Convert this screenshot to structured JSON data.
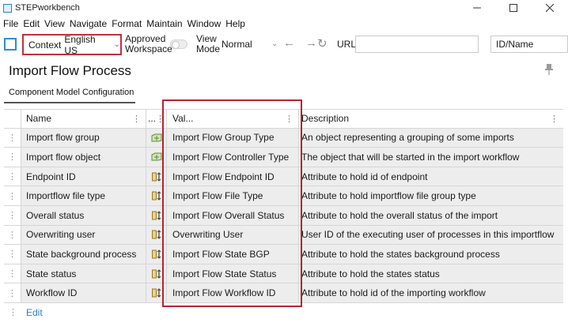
{
  "window": {
    "title": "STEPworkbench"
  },
  "menu": [
    "File",
    "Edit",
    "View",
    "Navigate",
    "Format",
    "Maintain",
    "Window",
    "Help"
  ],
  "toolbar": {
    "context_label": "Context",
    "context_value": "English US",
    "approved_line1": "Approved",
    "approved_line2": "Workspace",
    "view_line1": "View",
    "view_line2": "Mode",
    "view_mode_value": "Normal",
    "url_label": "URL",
    "id_name_value": "ID/Name"
  },
  "page": {
    "title": "Import Flow Process",
    "tab": "Component Model Configuration"
  },
  "table": {
    "columns": {
      "name": "Name",
      "icon": "...",
      "val": "Val...",
      "description": "Description"
    },
    "rows": [
      {
        "name": "Import flow group",
        "icon": "object-type-icon",
        "val": "Import Flow Group Type",
        "description": "An object representing a grouping of some imports"
      },
      {
        "name": "Import flow object",
        "icon": "object-type-icon",
        "val": "Import Flow Controller Type",
        "description": "The object that will be started in the import workflow"
      },
      {
        "name": "Endpoint ID",
        "icon": "attribute-icon",
        "val": "Import Flow Endpoint ID",
        "description": "Attribute to hold id of endpoint"
      },
      {
        "name": "Importflow file type",
        "icon": "attribute-icon",
        "val": "Import Flow File Type",
        "description": "Attribute to hold importflow file group type"
      },
      {
        "name": "Overall status",
        "icon": "attribute-icon",
        "val": "Import Flow Overall Status",
        "description": "Attribute to hold the overall status of the import"
      },
      {
        "name": "Overwriting user",
        "icon": "attribute-icon",
        "val": "Overwriting User",
        "description": "User ID of the executing user of processes in this importflow"
      },
      {
        "name": "State background process",
        "icon": "attribute-icon",
        "val": "Import Flow State BGP",
        "description": "Attribute to hold the states background process"
      },
      {
        "name": "State status",
        "icon": "attribute-icon",
        "val": "Import Flow State Status",
        "description": "Attribute to hold the states status"
      },
      {
        "name": "Workflow ID",
        "icon": "attribute-icon",
        "val": "Import Flow Workflow ID",
        "description": "Attribute to hold id of the importing workflow"
      }
    ],
    "edit_label": "Edit"
  },
  "colors": {
    "highlight": "#b5242f",
    "accent": "#2b8fd6",
    "link": "#2a7fc7"
  }
}
